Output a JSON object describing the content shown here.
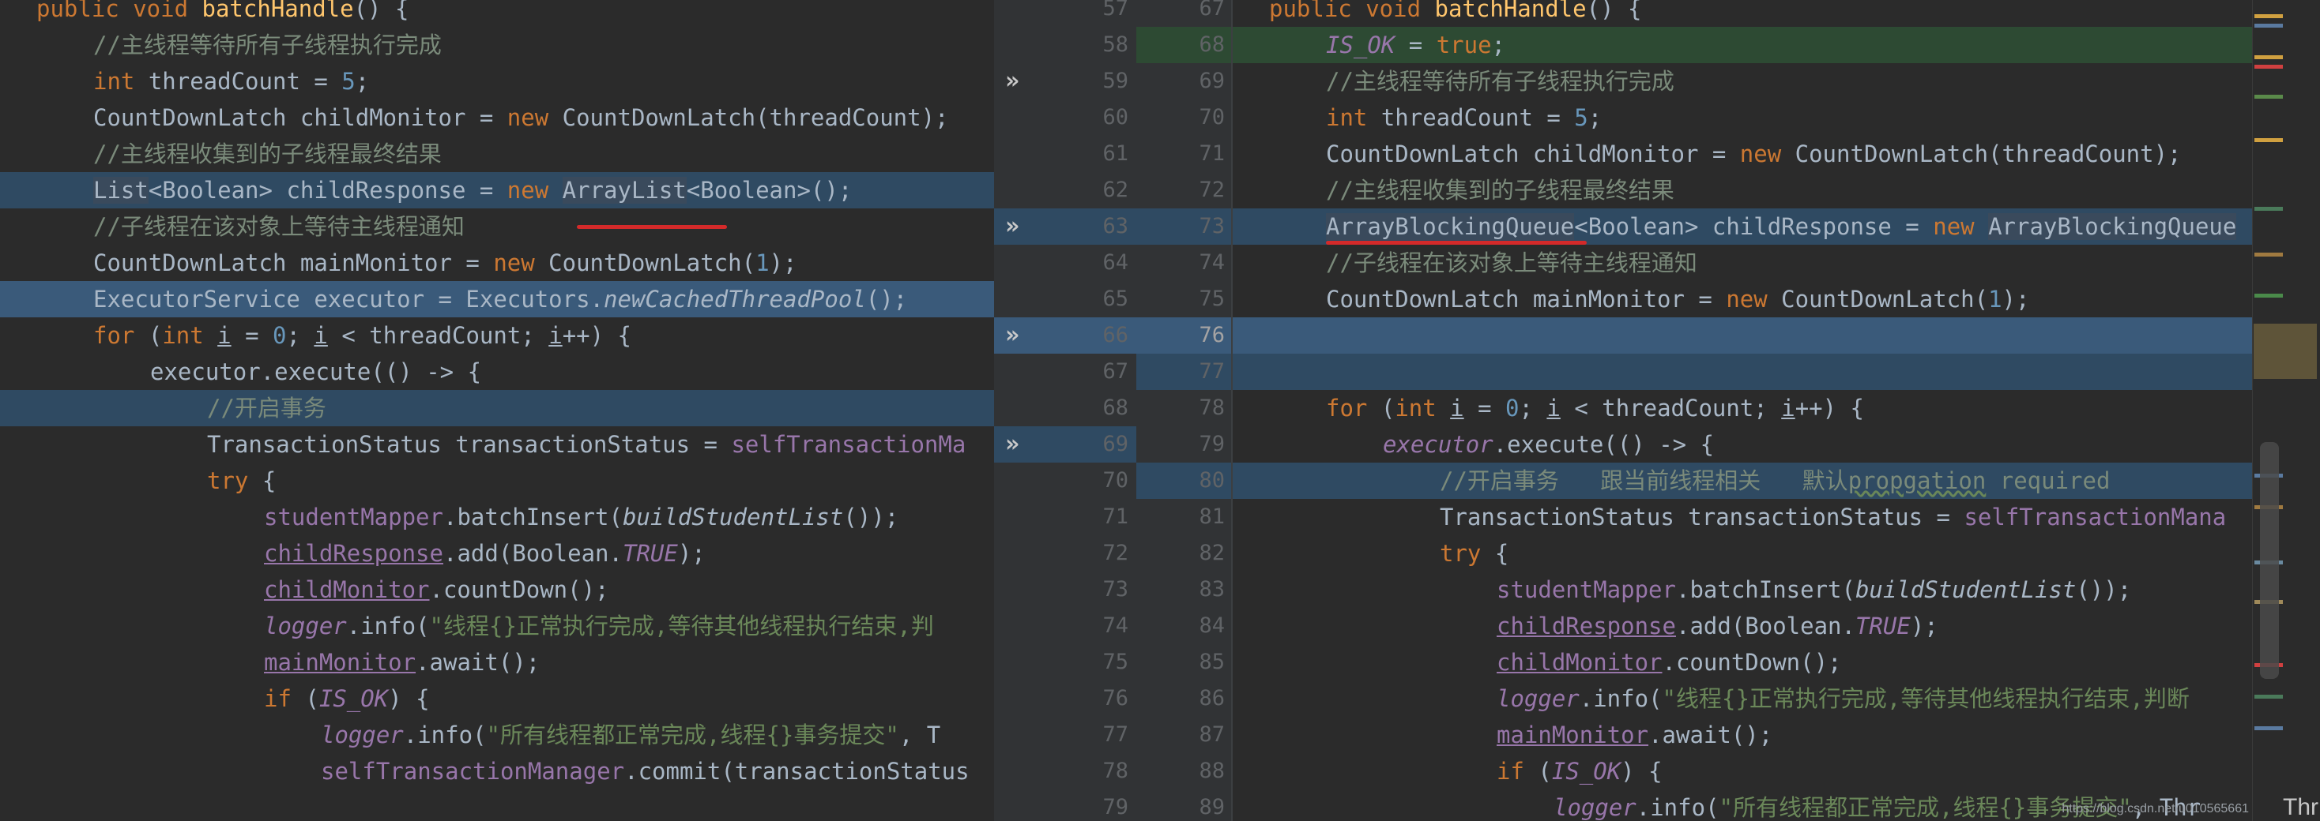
{
  "left": {
    "lines": [
      {
        "html": "<span class=\"kw\">public void </span><span class=\"fn\">batchHandle</span>() {",
        "indent": 0
      },
      {
        "html": "<span class=\"cm\">//主线程等待所有子线程执行完成</span>",
        "indent": 1
      },
      {
        "html": "<span class=\"kw\">int </span>threadCount = <span class=\"nm\">5</span>;",
        "indent": 1
      },
      {
        "html": "CountDownLatch childMonitor = <span class=\"kw\">new </span>CountDownLatch(threadCount);",
        "indent": 1
      },
      {
        "html": "<span class=\"cm\">//主线程收集到的子线程最终结果</span>",
        "indent": 1
      },
      {
        "html": "<span class=\"sel\">List</span>&lt;Boolean&gt; childResponse = <span class=\"kw\">new </span><span class=\"sel\">ArrayList</span>&lt;Boolean&gt;();",
        "indent": 1,
        "hl": "blue"
      },
      {
        "html": "<span class=\"cm\">//子线程在该对象上等待主线程通知</span>",
        "indent": 1
      },
      {
        "html": "CountDownLatch mainMonitor = <span class=\"kw\">new </span>CountDownLatch(<span class=\"nm\">1</span>);",
        "indent": 1
      },
      {
        "html": "ExecutorService executor = Executors.<span class=\"it\">newCachedThreadPool</span>();",
        "indent": 1,
        "hl": "blue-strong"
      },
      {
        "html": "<span class=\"kw\">for </span>(<span class=\"kw\">int </span><span class=\"ul\">i</span> = <span class=\"nm\">0</span>; <span class=\"ul\">i</span> &lt; threadCount; <span class=\"ul\">i</span>++) {",
        "indent": 1
      },
      {
        "html": "executor.execute(() -&gt; {",
        "indent": 2
      },
      {
        "html": "<span class=\"cm\">//开启事务</span>",
        "indent": 3,
        "hl": "blue"
      },
      {
        "html": "TransactionStatus transactionStatus = <span class=\"pu\">selfTransactionMa</span>",
        "indent": 3
      },
      {
        "html": "<span class=\"kw\">try </span>{",
        "indent": 3
      },
      {
        "html": "<span class=\"pu\">studentMapper</span>.batchInsert(<span class=\"it\">buildStudentList</span>());",
        "indent": 4
      },
      {
        "html": "<span class=\"pu ul\">childResponse</span>.add(Boolean.<span class=\"pu it\">TRUE</span>);",
        "indent": 4
      },
      {
        "html": "<span class=\"pu ul\">childMonitor</span>.countDown();",
        "indent": 4
      },
      {
        "html": "<span class=\"pu it\">logger</span>.info(<span class=\"st\">\"线程{}正常执行完成,等待其他线程执行结束,判</span>",
        "indent": 4
      },
      {
        "html": "<span class=\"pu ul\">mainMonitor</span>.await();",
        "indent": 4
      },
      {
        "html": "<span class=\"kw\">if </span>(<span class=\"pu it\">IS_OK</span>) {",
        "indent": 4
      },
      {
        "html": "<span class=\"pu it\">logger</span>.info(<span class=\"st\">\"所有线程都正常完成,线程{}事务提交\"</span>, T",
        "indent": 5
      },
      {
        "html": "<span class=\"pu\">selfTransactionManager</span>.commit(transactionStatus",
        "indent": 5
      }
    ]
  },
  "left_gutter": [
    "57",
    "58",
    "59",
    "60",
    "61",
    "62",
    "63",
    "64",
    "65",
    "66",
    "67",
    "68",
    "69",
    "70",
    "71",
    "72",
    "73",
    "74",
    "75",
    "76",
    "77",
    "78",
    "79"
  ],
  "right_gutter": [
    "67",
    "68",
    "69",
    "70",
    "71",
    "72",
    "73",
    "74",
    "75",
    "76",
    "77",
    "78",
    "79",
    "80",
    "81",
    "82",
    "83",
    "84",
    "85",
    "86",
    "87",
    "88",
    "89"
  ],
  "right": {
    "lines": [
      {
        "html": "<span class=\"kw\">public void </span><span class=\"fn\">batchHandle</span>() {",
        "indent": 0
      },
      {
        "html": "<span class=\"pu it\">IS_OK</span> = <span class=\"kw\">true</span>;",
        "indent": 1,
        "hl": "green"
      },
      {
        "html": "<span class=\"cm\">//主线程等待所有子线程执行完成</span>",
        "indent": 1
      },
      {
        "html": "<span class=\"kw\">int </span>threadCount = <span class=\"nm\">5</span>;",
        "indent": 1
      },
      {
        "html": "CountDownLatch childMonitor = <span class=\"kw\">new </span>CountDownLatch(threadCount);",
        "indent": 1
      },
      {
        "html": "<span class=\"cm\">//主线程收集到的子线程最终结果</span>",
        "indent": 1
      },
      {
        "html": "<span class=\"sel\">ArrayBlockingQueue</span>&lt;Boolean&gt; childResponse = <span class=\"kw\">new </span><span class=\"sel\">ArrayBlockingQueue</span>",
        "indent": 1,
        "hl": "blue"
      },
      {
        "html": "<span class=\"cm\">//子线程在该对象上等待主线程通知</span>",
        "indent": 1
      },
      {
        "html": "CountDownLatch mainMonitor = <span class=\"kw\">new </span>CountDownLatch(<span class=\"nm\">1</span>);",
        "indent": 1
      },
      {
        "html": "",
        "indent": 0,
        "hl": "blue-strong"
      },
      {
        "html": "",
        "indent": 0,
        "hl": "blue"
      },
      {
        "html": "<span class=\"kw\">for </span>(<span class=\"kw\">int </span><span class=\"ul\">i</span> = <span class=\"nm\">0</span>; <span class=\"ul\">i</span> &lt; threadCount; <span class=\"ul\">i</span>++) {",
        "indent": 1
      },
      {
        "html": "<span class=\"pu it\">executor</span>.execute(() -&gt; {",
        "indent": 2
      },
      {
        "html": "<span class=\"cm\">//开启事务   跟当前线程相关   默认<span class=\"wv\">propgation</span> required</span>",
        "indent": 3,
        "hl": "blue"
      },
      {
        "html": "TransactionStatus transactionStatus = <span class=\"pu\">selfTransactionMana</span>",
        "indent": 3
      },
      {
        "html": "<span class=\"kw\">try </span>{",
        "indent": 3
      },
      {
        "html": "<span class=\"pu\">studentMapper</span>.batchInsert(<span class=\"it\">buildStudentList</span>());",
        "indent": 4
      },
      {
        "html": "<span class=\"pu ul\">childResponse</span>.add(Boolean.<span class=\"pu it\">TRUE</span>);",
        "indent": 4
      },
      {
        "html": "<span class=\"pu ul\">childMonitor</span>.countDown();",
        "indent": 4
      },
      {
        "html": "<span class=\"pu it\">logger</span>.info(<span class=\"st\">\"线程{}正常执行完成,等待其他线程执行结束,判断</span>",
        "indent": 4
      },
      {
        "html": "<span class=\"pu ul\">mainMonitor</span>.await();",
        "indent": 4
      },
      {
        "html": "<span class=\"kw\">if </span>(<span class=\"pu it\">IS_OK</span>) {",
        "indent": 4
      },
      {
        "html": "<span class=\"pu it\">logger</span>.info(<span class=\"st\">\"所有线程都正常完成,线程{}事务提交\"</span>, Thr",
        "indent": 5
      }
    ]
  },
  "watermark": "https://blog.csdn.net/u010565661",
  "tail_text": "Thr"
}
